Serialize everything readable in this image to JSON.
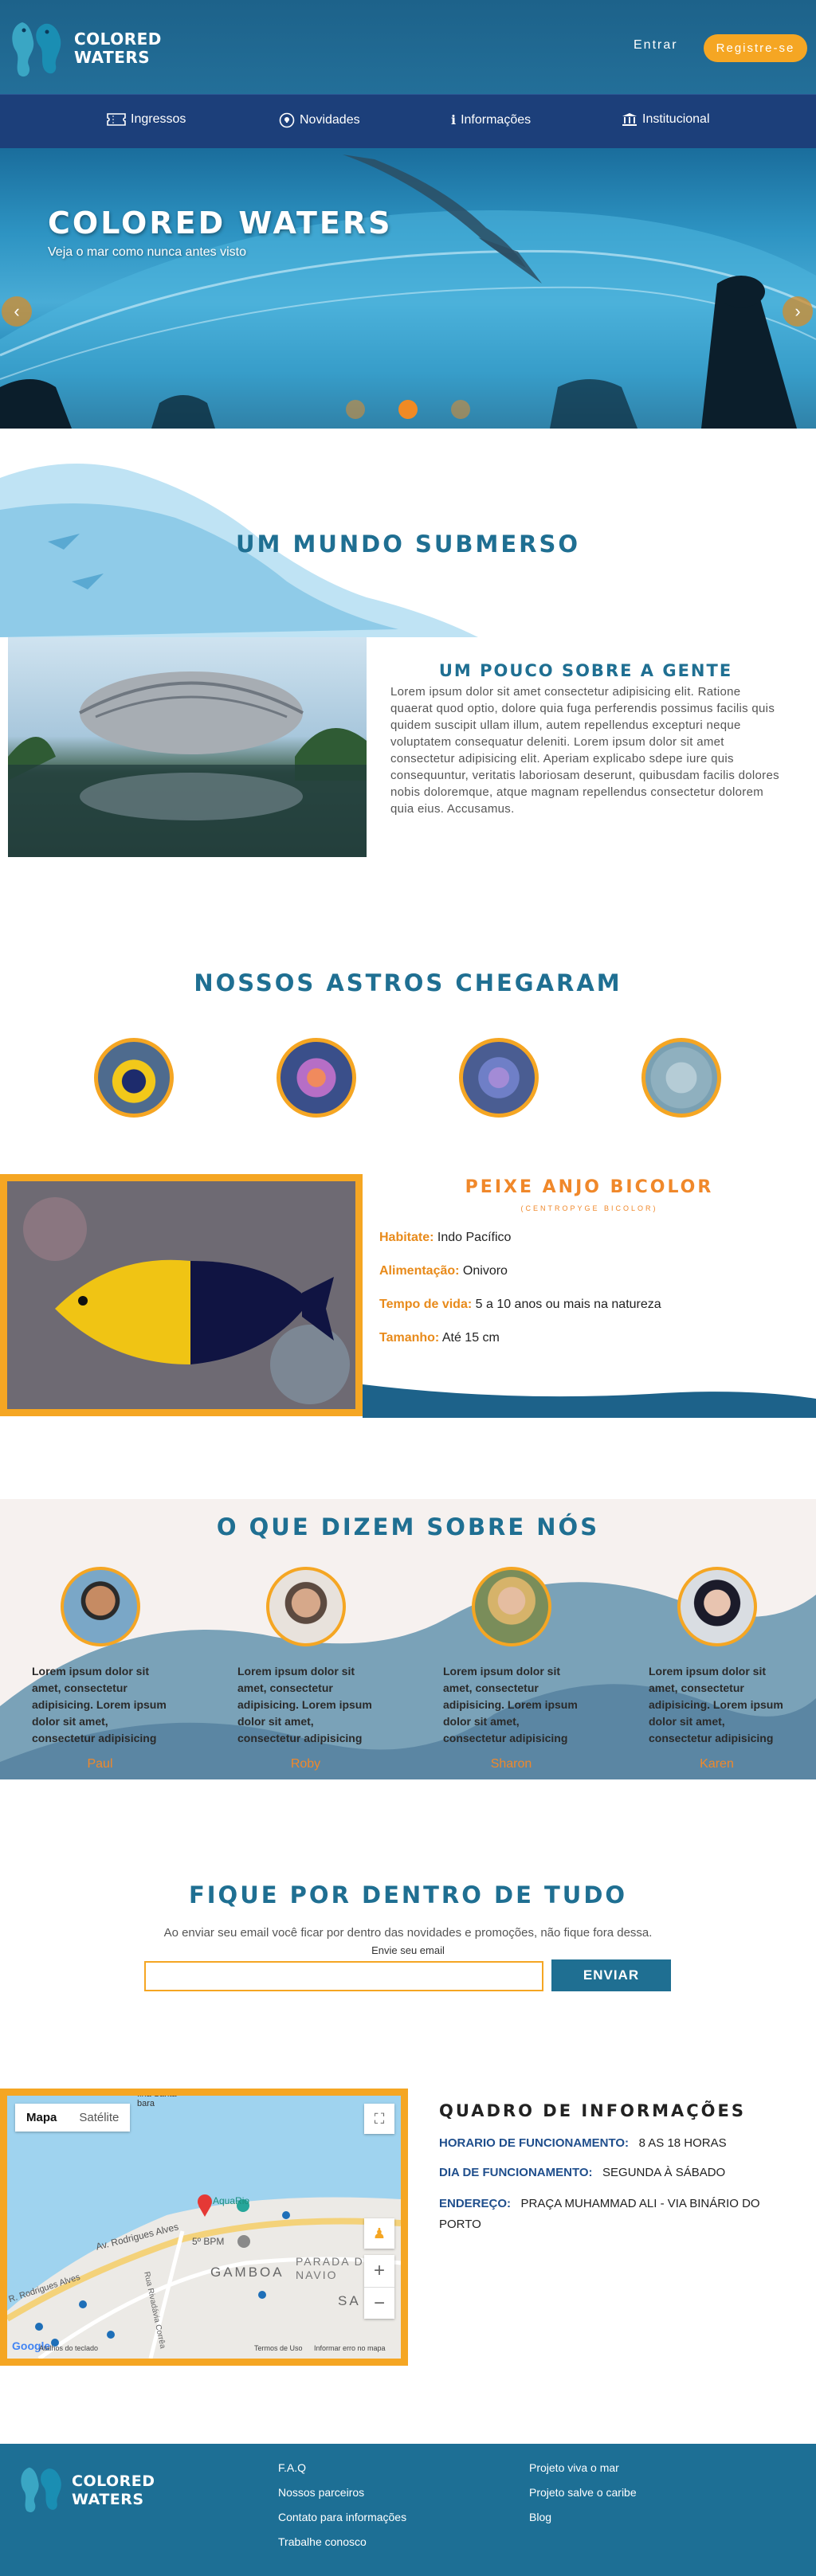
{
  "brand": {
    "name_line1": "COLORED",
    "name_line2": "WATERS"
  },
  "header": {
    "login": "Entrar",
    "register": "Registre-se"
  },
  "nav": [
    {
      "label": "Ingressos",
      "icon": "ticket-icon"
    },
    {
      "label": "Novidades",
      "icon": "lightbulb-icon"
    },
    {
      "label": "Informações",
      "icon": "info-icon"
    },
    {
      "label": "Institucional",
      "icon": "institution-icon"
    }
  ],
  "hero": {
    "title": "COLORED WATERS",
    "subtitle": "Veja o mar como nunca antes visto",
    "prev": "‹",
    "next": "›",
    "slides": 3,
    "active_slide": 2
  },
  "about": {
    "heading": "UM MUNDO SUBMERSO",
    "subheading": "UM POUCO SOBRE A GENTE",
    "text": "Lorem ipsum dolor sit amet consectetur adipisicing elit. Ratione quaerat quod optio, dolore quia fuga perferendis possimus facilis quis quidem suscipit ullam illum, autem repellendus excepturi neque voluptatem consequatur deleniti. Lorem ipsum dolor sit amet consectetur adipisicing elit. Aperiam explicabo sdepe iure quis consequuntur, veritatis laboriosam deserunt, quibusdam facilis dolores nobis doloremque, atque magnam repellendus consectetur dolorem quia eius. Accusamus."
  },
  "stars": {
    "heading": "NOSSOS ASTROS CHEGARAM",
    "featured": {
      "name": "PEIXE ANJO BICOLOR",
      "scientific": "(CENTROPYGE BICOLOR)",
      "facts": [
        {
          "label": "Habitate:",
          "value": "Indo Pacífico"
        },
        {
          "label": "Alimentação:",
          "value": "Onivoro"
        },
        {
          "label": "Tempo de vida:",
          "value": "5 a 10 anos ou mais na natureza"
        },
        {
          "label": "Tamanho:",
          "value": "Até 15 cm"
        }
      ]
    }
  },
  "testimonials": {
    "heading": "O QUE DIZEM SOBRE NÓS",
    "items": [
      {
        "text": "Lorem ipsum dolor sit amet, consectetur adipisicing. Lorem ipsum dolor sit amet, consectetur adipisicing",
        "name": "Paul"
      },
      {
        "text": "Lorem ipsum dolor sit amet, consectetur adipisicing. Lorem ipsum dolor sit amet, consectetur adipisicing",
        "name": "Roby"
      },
      {
        "text": "Lorem ipsum dolor sit amet, consectetur adipisicing. Lorem ipsum dolor sit amet, consectetur adipisicing",
        "name": "Sharon"
      },
      {
        "text": "Lorem ipsum dolor sit amet, consectetur adipisicing. Lorem ipsum dolor sit amet, consectetur adipisicing",
        "name": "Karen"
      }
    ]
  },
  "newsletter": {
    "heading": "FIQUE POR DENTRO DE TUDO",
    "text": "Ao enviar seu email você ficar por dentro das novidades e promoções, não fique fora dessa.",
    "label": "Envie seu email",
    "placeholder": "",
    "button": "ENVIAR"
  },
  "map": {
    "tab_map": "Mapa",
    "tab_sat": "Satélite",
    "labels": [
      "Ilha Santa bara",
      "Av. Rodrigues Alves",
      "AquaRio",
      "5º BPM",
      "GAMBOA",
      "PARADA DOS NAVIO",
      "SA",
      "Rua Rivadávia Corrêa",
      "R. Rodrigues Alves"
    ],
    "footer": [
      "Atalhos do teclado",
      "Termos de Uso",
      "Informar erro no mapa"
    ],
    "google": "Google"
  },
  "info": {
    "heading": "QUADRO DE INFORMAÇÕES",
    "rows": [
      {
        "label": "HORARIO DE FUNCIONAMENTO:",
        "value": "8 AS 18 HORAS"
      },
      {
        "label": "DIA DE FUNCIONAMENTO:",
        "value": "SEGUNDA À SÁBADO"
      },
      {
        "label": "ENDEREÇO:",
        "value": "PRAÇA MUHAMMAD ALI - VIA BINÁRIO DO PORTO"
      }
    ]
  },
  "footer": {
    "col1": [
      "F.A.Q",
      "Nossos parceiros",
      "Contato para informações",
      "Trabalhe conosco"
    ],
    "col2": [
      "Projeto viva o mar",
      "Projeto salve o caribe",
      "Blog"
    ]
  },
  "colors": {
    "primary": "#1d628a",
    "nav": "#1c3f7a",
    "accent": "#f5a623",
    "heading": "#1f6f92"
  }
}
